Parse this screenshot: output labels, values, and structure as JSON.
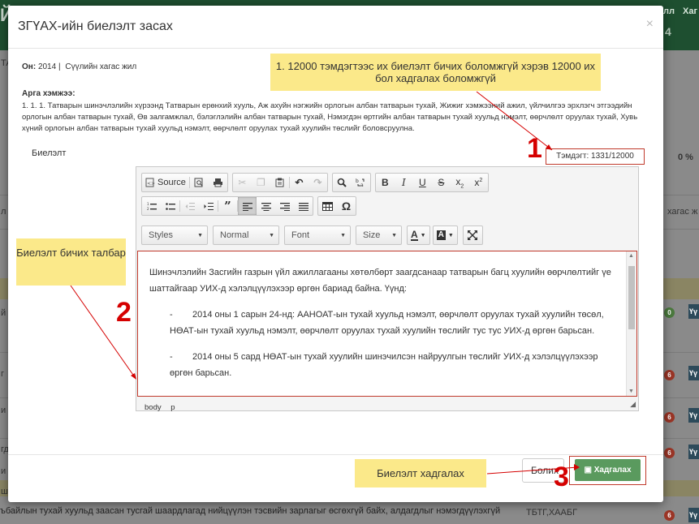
{
  "background": {
    "header_left": "Й",
    "header_links": [
      "лл",
      "Хаг"
    ],
    "header_number": "4",
    "right_texts": [
      "0 %",
      "хагас ж",
      "Үү"
    ],
    "tag_label": "Үү",
    "badge_green": "0",
    "badge_red": "6",
    "bottom_row_text": "ъбайлын тухай хуульд заасан тусгай шаардлагад нийцүүлэн тэсвийн зарлагыг өсгөхгүй байх, алдагдлыг нэмэгдүүлэхгүй",
    "bottom_row_code": "ТБТГ,ХААБГ",
    "left_fragments": [
      "ТА",
      "л",
      "й",
      "г",
      "и",
      "гд",
      "и",
      "ш"
    ]
  },
  "modal": {
    "title": "ЗГҮАХ-ийн биелэлт засах",
    "close_symbol": "×",
    "year_label": "Он:",
    "year_value": "2014 |",
    "period": "Сүүлийн хагас жил",
    "measure_title": "Арга хэмжээ:",
    "measure_text": "1. 1. 1. Татварын шинэчлэлийн хүрээнд Татварын ерөнхий хууль, Аж ахуйн нэгжийн орлогын албан татварын тухай, Жижиг хэмжээний ажил, үйлчилгээ эрхлэгч этгээдийн орлогын албан татварын тухай, Өв залгамжлал, бэлэглэлийн албан татварын тухай, Нэмэгдэн өртгийн албан татварын тухай хуульд нэмэлт, өөрчлөлт оруулах тухай, Хувь хүний орлогын албан татварын тухай хуульд нэмэлт, өөрчлөлт оруулах тухай хуулийн төслийг боловсруулна.",
    "field_label": "Биелэлт",
    "char_counter": "Тэмдэгт: 1331/12000",
    "close_button": "Болих",
    "save_button": "Хадгалах"
  },
  "editor": {
    "toolbar_source": "Source",
    "combo_styles": "Styles",
    "combo_format": "Normal",
    "combo_font": "Font",
    "combo_size": "Size",
    "color_text": "A",
    "color_bg": "A",
    "paragraph1": "Шинэчлэлийн Засгийн газрын үйл ажиллагааны хөтөлбөрт заагдсанаар татварын багц хуулийн өөрчлөлтийг үе шаттайгаар УИХ-д хэлэлцүүлэхээр өргөн бариад байна. Үүнд:",
    "item1_dash": "-",
    "item1": "2014 оны 1 сарын 24-нд: ААНОАТ-ын тухай хуульд нэмэлт, өөрчлөлт оруулах тухай хуулийн төсөл, НӨАТ-ын тухай хуульд нэмэлт, өөрчлөлт оруулах тухай хуулийн төслийг тус тус УИХ-д өргөн барьсан.",
    "item2_dash": "-",
    "item2": "2014 оны 5 сард НӨАТ-ын тухай хуулийн шинэчилсэн найруулгын төслийг УИХ-д хэлэлцүүлэхээр өргөн барьсан.",
    "path_body": "body",
    "path_p": "p"
  },
  "annotations": {
    "callout1": "1. 12000 тэмдэгтээс их биелэлт бичих боломжгүй хэрэв 12000 их бол хадгалах боломжгүй",
    "callout2": "Биелэлт бичих талбар",
    "callout3": "Биелэлт хадгалах",
    "marker1": "1",
    "marker2": "2",
    "marker3": "3",
    "callout_color": "#fbe98a",
    "marker_color": "#d50000"
  }
}
